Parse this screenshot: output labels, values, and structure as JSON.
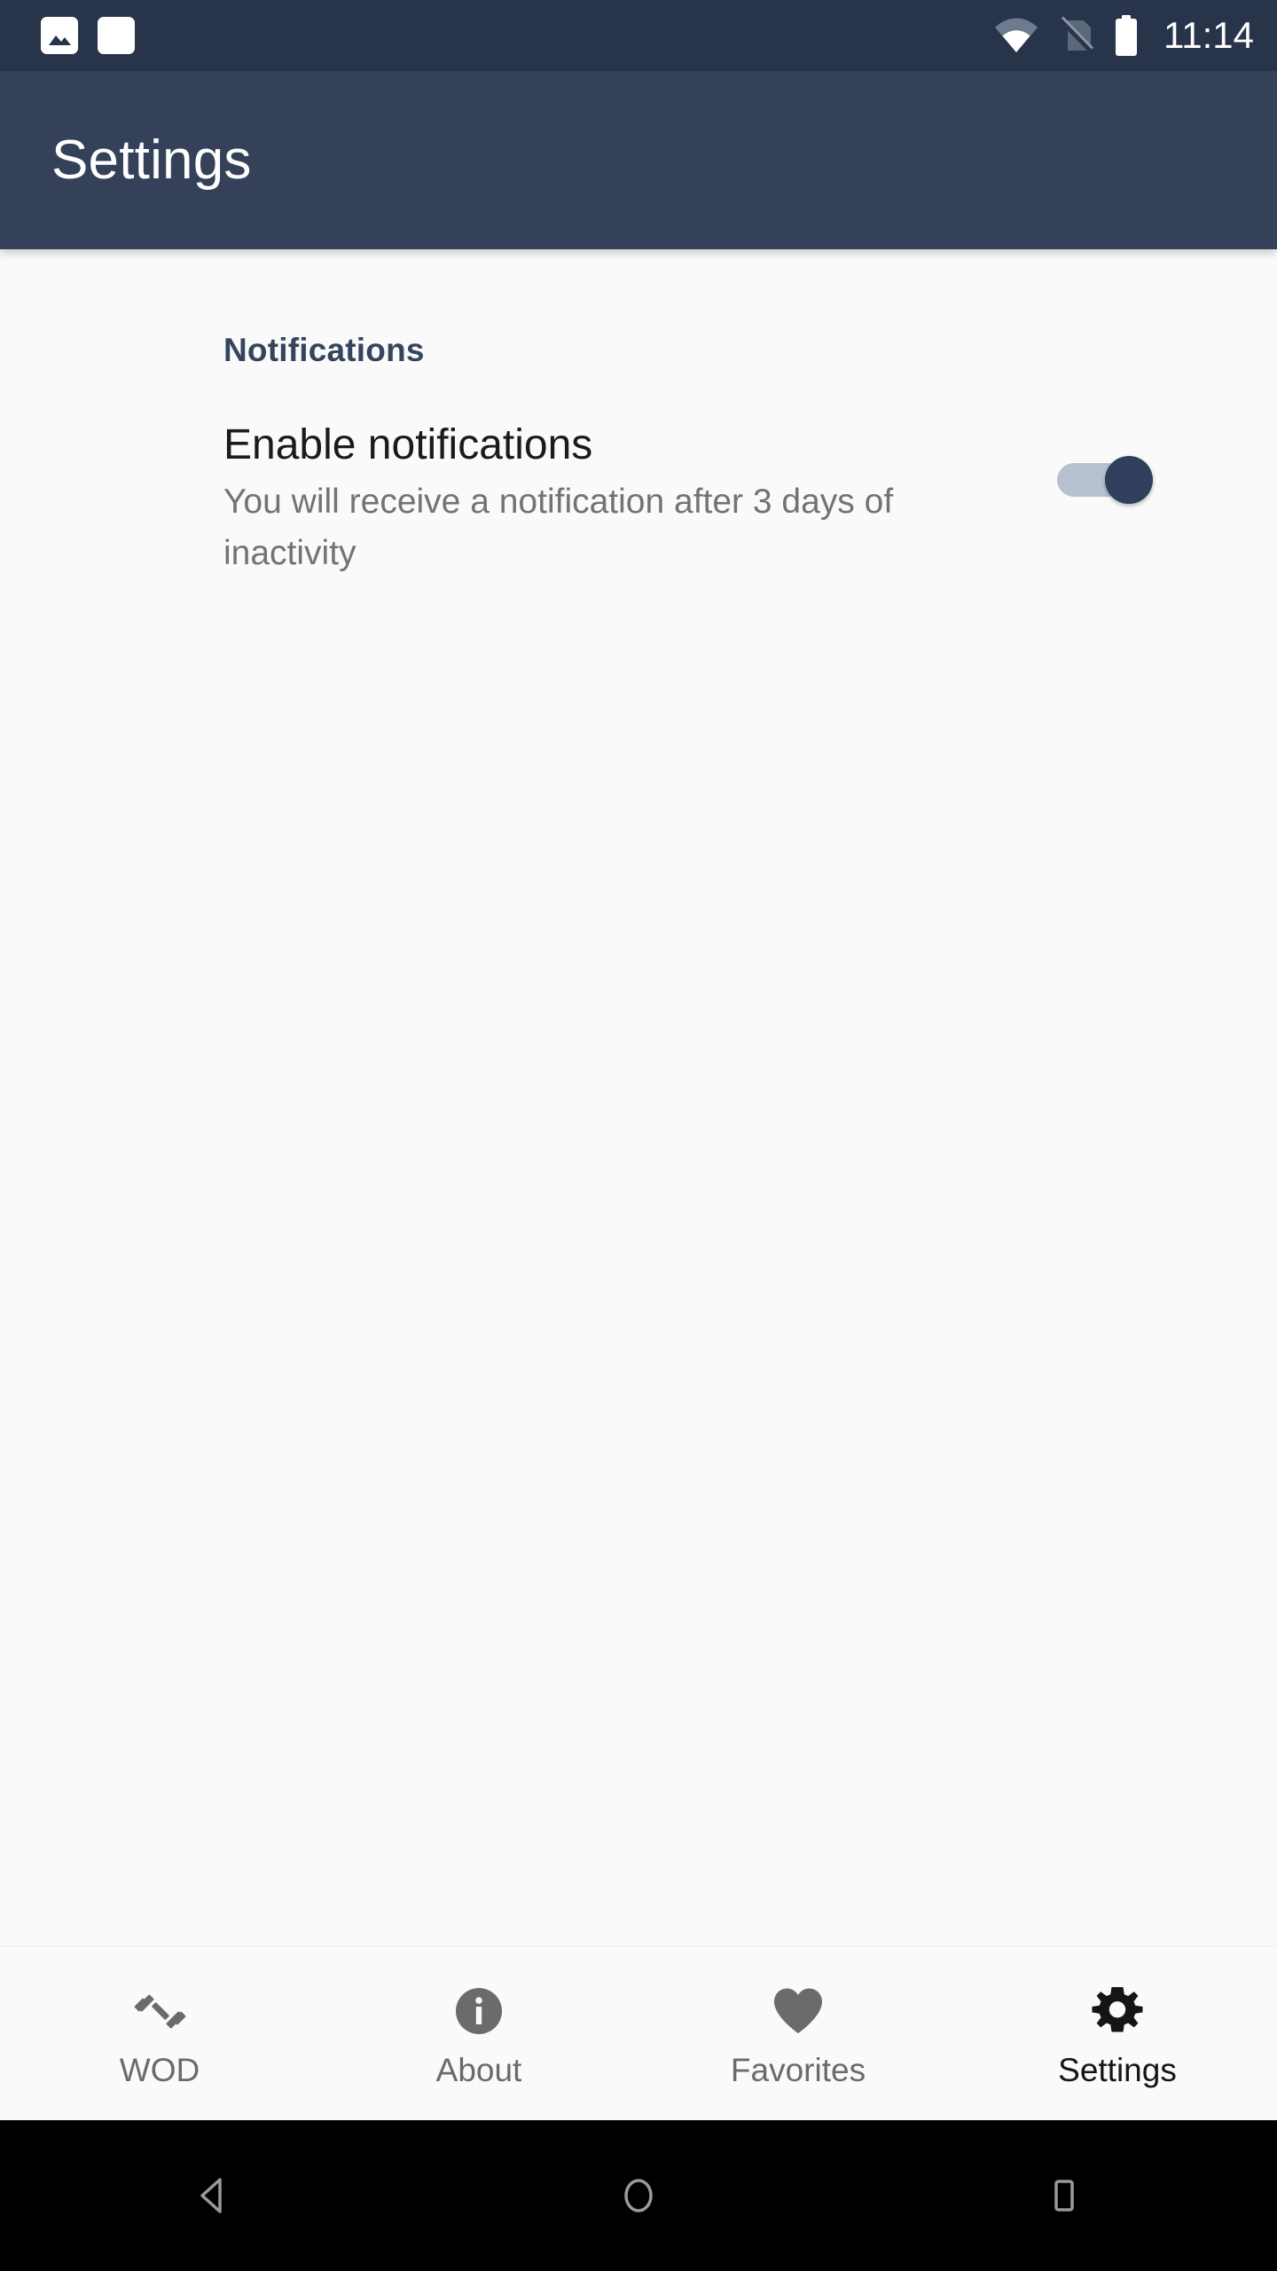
{
  "status_bar": {
    "time": "11:14",
    "notification_icons": [
      "image-icon",
      "blank-app-icon"
    ],
    "system_icons": [
      "wifi-icon",
      "no-sim-icon",
      "battery-icon"
    ],
    "background_color": "#27344a"
  },
  "app_bar": {
    "title": "Settings",
    "background_color": "#344158",
    "title_color": "#ffffff"
  },
  "content": {
    "section_header": "Notifications",
    "preference": {
      "title": "Enable notifications",
      "summary": "You will receive a notification after 3 days of inactivity",
      "switch_state": "on",
      "switch_state_label": "On",
      "track_color": "#b8c2ce",
      "thumb_color": "#2f3f5c"
    },
    "background_color": "#fafafa"
  },
  "bottom_nav": {
    "items": [
      {
        "label": "WOD",
        "icon": "dumbbell-icon",
        "active": false
      },
      {
        "label": "About",
        "icon": "info-circle-icon",
        "active": false
      },
      {
        "label": "Favorites",
        "icon": "heart-icon",
        "active": false
      },
      {
        "label": "Settings",
        "icon": "gear-icon",
        "active": true
      }
    ],
    "inactive_color": "#6b6b6b",
    "active_color": "#151515"
  },
  "android_nav": {
    "buttons": [
      "back-button",
      "home-button",
      "recents-button"
    ],
    "background_color": "#000000",
    "icon_color": "#9a9a9a"
  }
}
